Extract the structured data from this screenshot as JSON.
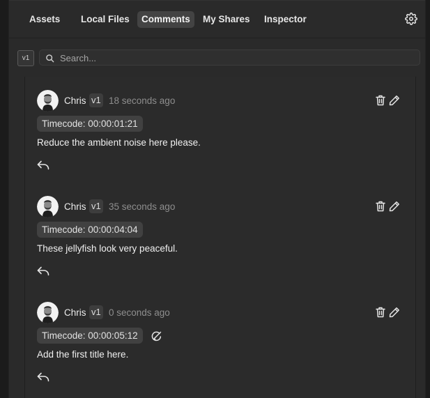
{
  "tabs": [
    {
      "label": "Assets",
      "active": false
    },
    {
      "label": "Local Files",
      "active": false
    },
    {
      "label": "Comments",
      "active": true
    },
    {
      "label": "My Shares",
      "active": false
    },
    {
      "label": "Inspector",
      "active": false
    }
  ],
  "settings_icon": "gear-icon",
  "toolbar": {
    "version_label": "v1",
    "search_placeholder": "Search..."
  },
  "comments": [
    {
      "author": "Chris",
      "version": "v1",
      "time": "18 seconds ago",
      "timecode": "Timecode: 00:00:01:21",
      "text": "Reduce the ambient noise here please.",
      "has_annotation": false
    },
    {
      "author": "Chris",
      "version": "v1",
      "time": "35 seconds ago",
      "timecode": "Timecode: 00:00:04:04",
      "text": "These jellyfish look very peaceful.",
      "has_annotation": false
    },
    {
      "author": "Chris",
      "version": "v1",
      "time": "0 seconds ago",
      "timecode": "Timecode: 00:00:05:12",
      "text": "Add the first title here.",
      "has_annotation": true
    }
  ],
  "colors": {
    "panel_bg": "#2a2a2a",
    "active_tab": "#434343",
    "timecode_bg": "#414141",
    "muted_text": "#8e8e8e"
  }
}
